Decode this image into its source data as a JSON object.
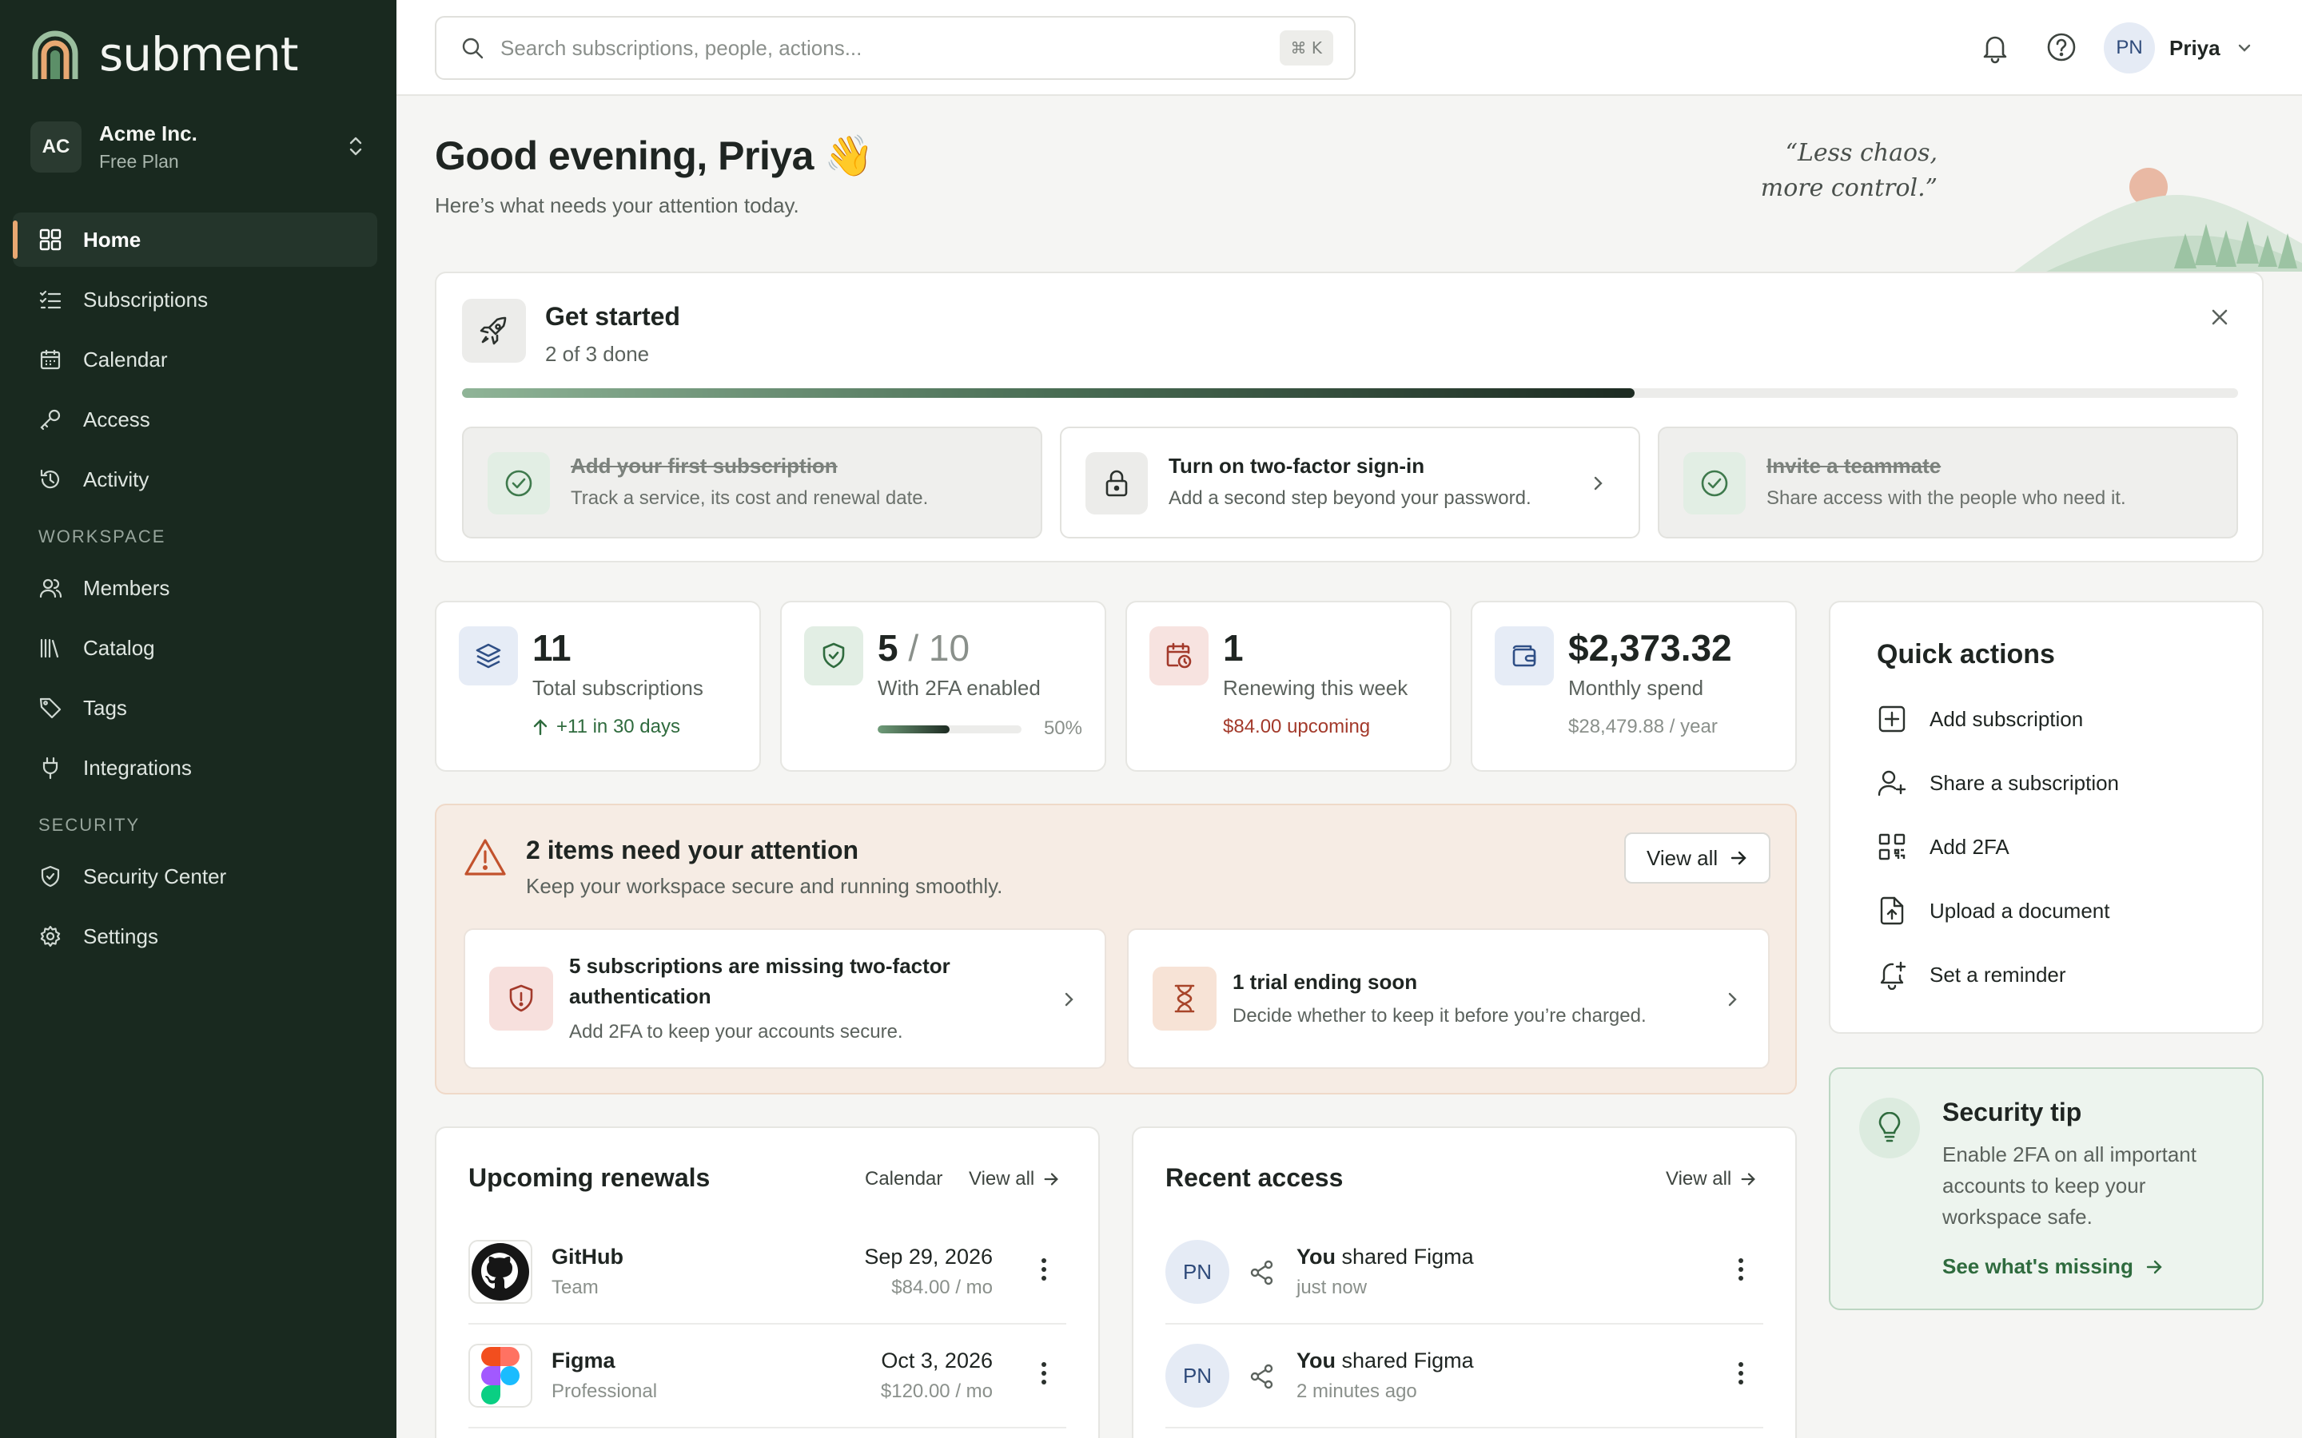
{
  "brand": {
    "name": "subment"
  },
  "org": {
    "initials": "AC",
    "name": "Acme Inc.",
    "plan": "Free Plan"
  },
  "nav": {
    "main": [
      {
        "label": "Home",
        "icon": "grid-icon"
      },
      {
        "label": "Subscriptions",
        "icon": "list-check-icon"
      },
      {
        "label": "Calendar",
        "icon": "calendar-icon"
      },
      {
        "label": "Access",
        "icon": "key-icon"
      },
      {
        "label": "Activity",
        "icon": "history-icon"
      }
    ],
    "workspace_heading": "WORKSPACE",
    "workspace": [
      {
        "label": "Members",
        "icon": "users-icon"
      },
      {
        "label": "Catalog",
        "icon": "library-icon"
      },
      {
        "label": "Tags",
        "icon": "tag-icon"
      },
      {
        "label": "Integrations",
        "icon": "plug-icon"
      }
    ],
    "security_heading": "SECURITY",
    "security": [
      {
        "label": "Security Center",
        "icon": "shield-icon"
      },
      {
        "label": "Settings",
        "icon": "gear-icon"
      }
    ]
  },
  "search": {
    "placeholder": "Search subscriptions, people, actions...",
    "shortcut": "⌘ K"
  },
  "user": {
    "initials": "PN",
    "name": "Priya"
  },
  "greeting": {
    "title": "Good evening, Priya 👋",
    "subtitle": "Here’s what needs your attention today."
  },
  "quote": {
    "line1": "“Less chaos,",
    "line2": "more control.”"
  },
  "get_started": {
    "title": "Get started",
    "progress_text": "2 of 3 done",
    "progress": 0.66,
    "steps": [
      {
        "title": "Add your first subscription",
        "desc": "Track a service, its cost and renewal date.",
        "done": true
      },
      {
        "title": "Turn on two-factor sign-in",
        "desc": "Add a second step beyond your password.",
        "done": false
      },
      {
        "title": "Invite a teammate",
        "desc": "Share access with the people who need it.",
        "done": true
      }
    ]
  },
  "stats": {
    "total": {
      "value": "11",
      "label": "Total subscriptions",
      "extra": "+11 in 30 days"
    },
    "twofa": {
      "value": "5",
      "total": "/ 10",
      "label": "With 2FA enabled",
      "percent_text": "50%",
      "fraction": 0.5
    },
    "renewing": {
      "value": "1",
      "label": "Renewing this week",
      "extra": "$84.00 upcoming"
    },
    "spend": {
      "value": "$2,373.32",
      "label": "Monthly spend",
      "extra": "$28,479.88 / year"
    }
  },
  "attention": {
    "title": "2 items need your attention",
    "subtitle": "Keep your workspace secure and running smoothly.",
    "view_all": "View all",
    "items": [
      {
        "title_line1": "5 subscriptions are missing two-factor",
        "title_line2": "authentication",
        "desc": "Add 2FA to keep your accounts secure."
      },
      {
        "title": "1 trial ending soon",
        "desc": "Decide whether to keep it before you’re charged."
      }
    ]
  },
  "quick_actions": {
    "title": "Quick actions",
    "items": [
      {
        "label": "Add subscription",
        "icon": "plus-square-icon"
      },
      {
        "label": "Share a subscription",
        "icon": "user-plus-icon"
      },
      {
        "label": "Add 2FA",
        "icon": "qr-code-icon"
      },
      {
        "label": "Upload a document",
        "icon": "file-upload-icon"
      },
      {
        "label": "Set a reminder",
        "icon": "bell-plus-icon"
      }
    ]
  },
  "security_tip": {
    "title": "Security tip",
    "desc": "Enable 2FA on all important accounts to keep your workspace safe.",
    "link": "See what's missing"
  },
  "renewals": {
    "title": "Upcoming renewals",
    "calendar_link": "Calendar",
    "view_all": "View all",
    "rows": [
      {
        "name": "GitHub",
        "plan": "Team",
        "date": "Sep 29, 2026",
        "price": "$84.00 / mo"
      },
      {
        "name": "Figma",
        "plan": "Professional",
        "date": "Oct 3, 2026",
        "price": "$120.00 / mo"
      }
    ]
  },
  "recent_access": {
    "title": "Recent access",
    "view_all": "View all",
    "rows": [
      {
        "initials": "PN",
        "actor": "You",
        "action": "shared Figma",
        "time": "just now"
      },
      {
        "initials": "PN",
        "actor": "You",
        "action": "shared Figma",
        "time": "2 minutes ago"
      }
    ]
  },
  "colors": {
    "sidebar": "#19291f",
    "accent": "#e8a872",
    "success": "#2f6b3e",
    "danger": "#a33a2b",
    "attention_bg": "#f6ece4"
  }
}
